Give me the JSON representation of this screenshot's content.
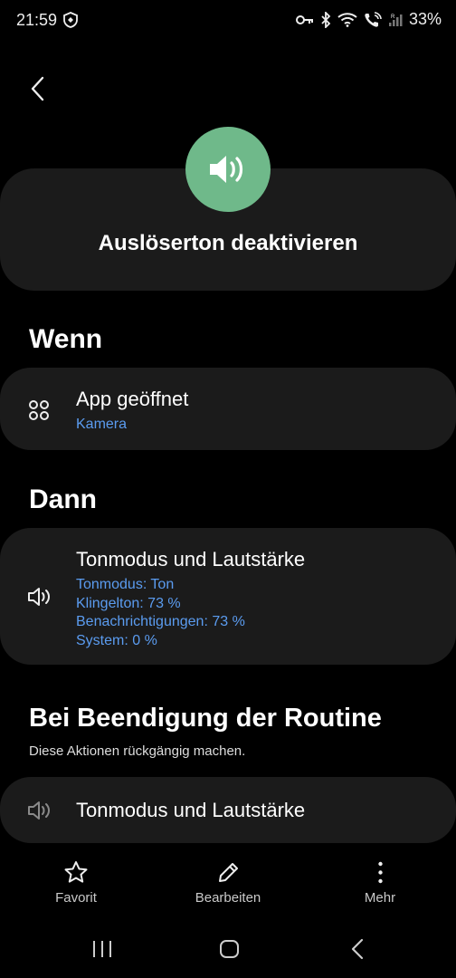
{
  "status": {
    "time": "21:59",
    "battery": "33%"
  },
  "routine": {
    "title": "Auslöserton deaktivieren",
    "icon": "speaker-icon",
    "icon_color": "#6fb98a"
  },
  "when": {
    "heading": "Wenn",
    "item": {
      "title": "App geöffnet",
      "detail": "Kamera",
      "icon": "apps-icon"
    }
  },
  "then": {
    "heading": "Dann",
    "item": {
      "title": "Tonmodus und Lautstärke",
      "icon": "volume-icon",
      "details": [
        "Tonmodus: Ton",
        "Klingelton: 73 %",
        "Benachrichtigungen: 73 %",
        "System: 0 %"
      ]
    }
  },
  "on_end": {
    "heading": "Bei Beendigung der Routine",
    "note": "Diese Aktionen rückgängig machen.",
    "item": {
      "title": "Tonmodus und Lautstärke",
      "icon": "volume-icon"
    }
  },
  "actions": {
    "favorite": "Favorit",
    "edit": "Bearbeiten",
    "more": "Mehr"
  },
  "colors": {
    "accent_link": "#5b9cf0",
    "card_bg": "#1b1b1b"
  }
}
